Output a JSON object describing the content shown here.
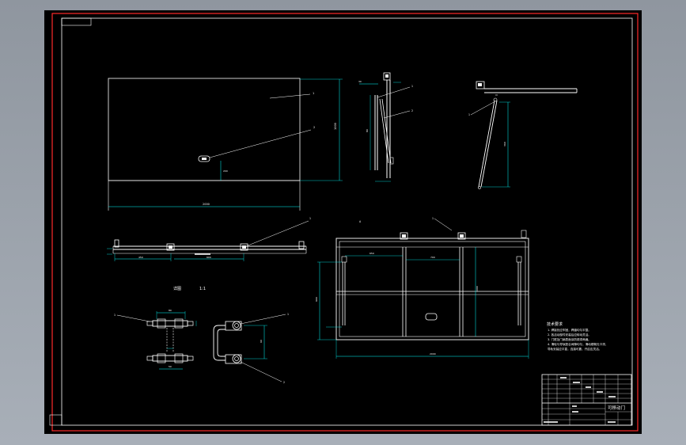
{
  "drawing": {
    "title_block_name": "可移动门",
    "scale_label": "1:1",
    "detail_label": "详图",
    "tech_notes_title": "技术要求",
    "tech_notes": [
      "1. 焊接处应牢固，焊缝均匀平整。",
      "2. 各活动部件安装后应转动灵活。",
      "3. 门框及门扇表面涂防锈漆两遍。",
      "4. 滑轮与导轨配合间隙均匀，滑动顺畅无卡滞，",
      "    导轨安装应平直，连接可靠，开启应灵活。"
    ]
  },
  "colors": {
    "background": "#000000",
    "border": "#ff2a2a",
    "geometry": "#ffffff",
    "dimension": "#00ffff",
    "leader": "#ffffff"
  }
}
